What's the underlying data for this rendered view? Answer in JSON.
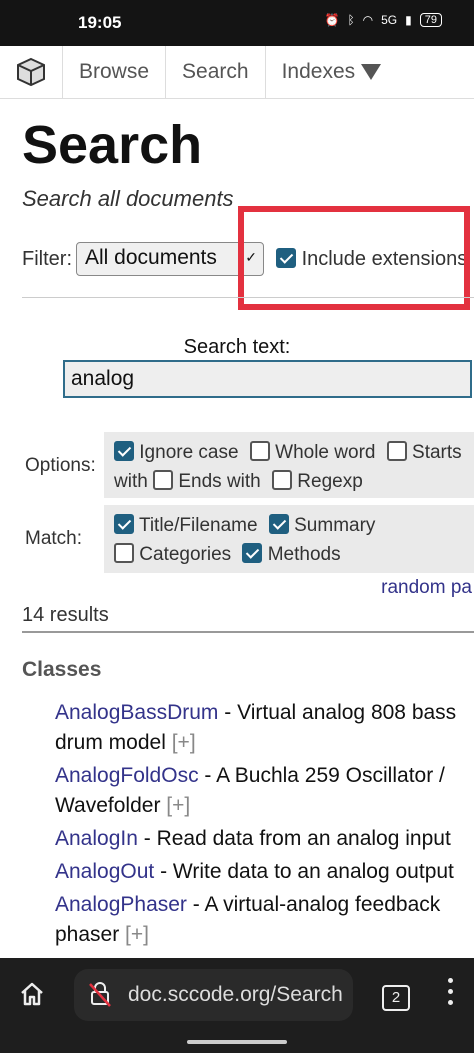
{
  "status_bar": {
    "time": "19:05",
    "network": "5G",
    "battery": "79"
  },
  "nav": {
    "browse": "Browse",
    "search": "Search",
    "indexes": "Indexes"
  },
  "page": {
    "title": "Search",
    "subtitle": "Search all documents"
  },
  "filter": {
    "label": "Filter:",
    "selected": "All documents",
    "include_extensions_label": "Include extensions",
    "include_extensions_checked": true
  },
  "search": {
    "label": "Search text:",
    "value": "analog"
  },
  "options": {
    "label": "Options:",
    "items": [
      {
        "label": "Ignore case",
        "checked": true
      },
      {
        "label": "Whole word",
        "checked": false
      },
      {
        "label": "Starts with",
        "checked": false
      },
      {
        "label": "Ends with",
        "checked": false
      },
      {
        "label": "Regexp",
        "checked": false
      }
    ]
  },
  "match": {
    "label": "Match:",
    "items": [
      {
        "label": "Title/Filename",
        "checked": true
      },
      {
        "label": "Summary",
        "checked": true
      },
      {
        "label": "Categories",
        "checked": false
      },
      {
        "label": "Methods",
        "checked": true
      }
    ]
  },
  "random_link": "random pa",
  "results_count": "14 results",
  "classes_heading": "Classes",
  "results": [
    {
      "name": "AnalogBassDrum",
      "desc": " - Virtual analog 808 bass drum model ",
      "more": "[+]"
    },
    {
      "name": "AnalogFoldOsc",
      "desc": " - A Buchla 259 Oscillator / Wavefolder ",
      "more": "[+]"
    },
    {
      "name": "AnalogIn",
      "desc": " - Read data from an analog input",
      "more": ""
    },
    {
      "name": "AnalogOut",
      "desc": " - Write data to an analog output",
      "more": ""
    },
    {
      "name": "AnalogPhaser",
      "desc": " - A virtual-analog feedback phaser ",
      "more": "[+]"
    }
  ],
  "browser": {
    "url": "doc.sccode.org/Search",
    "tab_count": "2"
  },
  "colors": {
    "highlight": "#e3313f",
    "checkbox": "#1f5f80",
    "link": "#33338a"
  }
}
